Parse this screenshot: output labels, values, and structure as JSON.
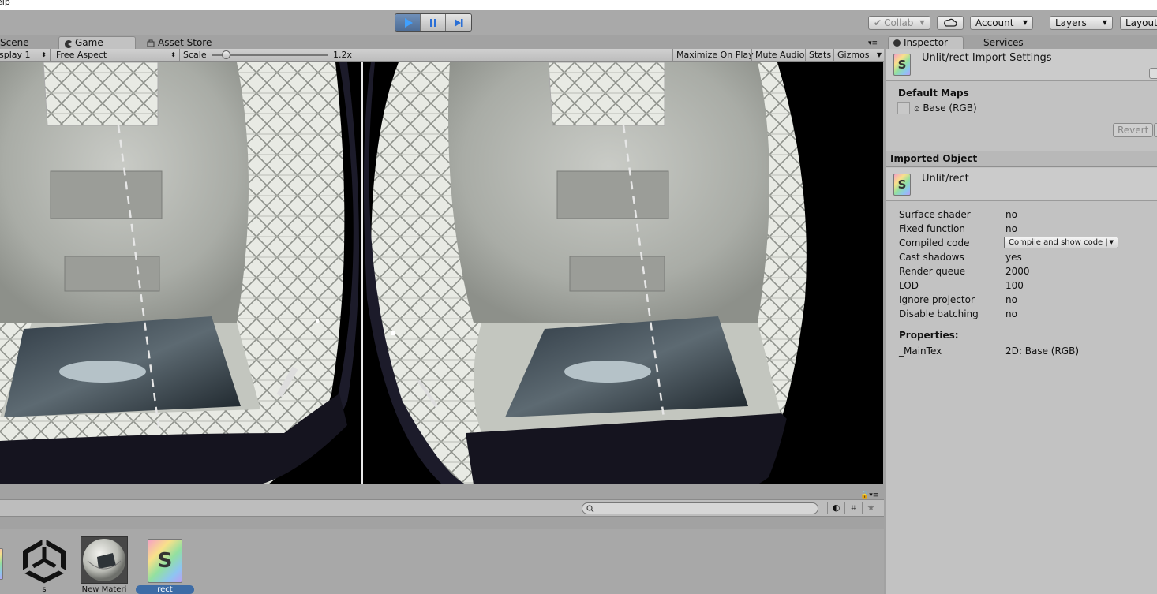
{
  "menubar": {
    "help_partial": "elp"
  },
  "toolbar": {
    "play_active": true,
    "collab_label": "Collab",
    "account_label": "Account",
    "layers_label": "Layers",
    "layout_label": "Layout"
  },
  "game": {
    "tabs": {
      "scene": "Scene",
      "game": "Game",
      "asset_store": "Asset Store"
    },
    "display_label": "splay 1",
    "aspect_label": "Free Aspect",
    "scale_label": "Scale",
    "scale_value": "1.2x",
    "scale_slider_fraction": 0.12,
    "maximize_label": "Maximize On Play",
    "mute_label": "Mute Audio",
    "stats_label": "Stats",
    "gizmos_label": "Gizmos"
  },
  "project": {
    "search_placeholder": "",
    "assets": [
      {
        "label": "",
        "icon": "shader-icon-partial"
      },
      {
        "label": "s",
        "icon": "unity-logo-icon"
      },
      {
        "label": "New Materi",
        "icon": "material-sphere-icon"
      },
      {
        "label": "rect",
        "icon": "shader-icon",
        "selected": true
      }
    ]
  },
  "inspector": {
    "tabs": {
      "inspector": "Inspector",
      "services": "Services"
    },
    "import_title": "Unlit/rect Import Settings",
    "default_maps_header": "Default Maps",
    "base_map_label": "Base (RGB)",
    "revert_label": "Revert",
    "imported_header": "Imported Object",
    "object_name": "Unlit/rect",
    "properties": [
      {
        "key": "Surface shader",
        "value": "no"
      },
      {
        "key": "Fixed function",
        "value": "no"
      },
      {
        "key": "Compiled code",
        "value": "Compile and show code |"
      },
      {
        "key": "Cast shadows",
        "value": "yes"
      },
      {
        "key": "Render queue",
        "value": "2000"
      },
      {
        "key": "LOD",
        "value": "100"
      },
      {
        "key": "Ignore projector",
        "value": "no"
      },
      {
        "key": "Disable batching",
        "value": "no"
      }
    ],
    "properties_header": "Properties:",
    "shader_props": [
      {
        "key": "_MainTex",
        "value": "2D: Base (RGB)"
      }
    ]
  },
  "colors": {
    "play_blue": "#4e6d96",
    "panel_bg": "#c2c2c2",
    "editor_bg": "#a2a2a2"
  }
}
